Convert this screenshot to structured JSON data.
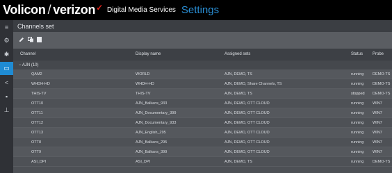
{
  "topbar": {
    "brand": "Volicon",
    "slash": "/",
    "verizon": "verizon",
    "checkmark": "✓",
    "dms": "Digital Media Services",
    "settings": "Settings"
  },
  "header": {
    "title": "Channels set"
  },
  "toolbar": {
    "icons": [
      "edit-icon",
      "copy-icon",
      "delete-icon"
    ]
  },
  "sidebar": {
    "items": [
      {
        "icon": "≡",
        "name": "menu-icon"
      },
      {
        "icon": "⚙",
        "name": "gear-icon"
      },
      {
        "icon": "✱",
        "name": "tools-icon"
      },
      {
        "icon": "▭",
        "name": "monitor-icon",
        "active": true
      },
      {
        "icon": "<",
        "name": "share-icon"
      },
      {
        "icon": "▪",
        "name": "storage-icon"
      },
      {
        "icon": "⊥",
        "name": "user-icon"
      }
    ]
  },
  "table": {
    "columns": {
      "channel": "Channel",
      "display": "Display name",
      "sets": "Assigned sets",
      "status": "Status",
      "probe": "Probe"
    },
    "group": "− AJN (10)",
    "rows": [
      {
        "channel": "QAM2",
        "display": "WORLD",
        "sets": "AJN, DEMO, TS",
        "status": "running",
        "probe": "DEMO-TS"
      },
      {
        "channel": "WHDH-HD",
        "display": "WHDH-HD",
        "sets": "AJN, DEMO, Share Channels, TS",
        "status": "running",
        "probe": "DEMO-TS"
      },
      {
        "channel": "THIS-TV",
        "display": "THIS-TV",
        "sets": "AJN, DEMO, TS",
        "status": "stopped",
        "probe": "DEMO-TS"
      },
      {
        "channel": "OTT10",
        "display": "AJN_Balkans_933",
        "sets": "AJN, DEMO, OTT CLOUD",
        "status": "running",
        "probe": "WIN7"
      },
      {
        "channel": "OTT11",
        "display": "AJN_Documentary_399",
        "sets": "AJN, DEMO, OTT CLOUD",
        "status": "running",
        "probe": "WIN7"
      },
      {
        "channel": "OTT12",
        "display": "AJN_Documentary_933",
        "sets": "AJN, DEMO, OTT CLOUD",
        "status": "running",
        "probe": "WIN7"
      },
      {
        "channel": "OTT13",
        "display": "AJN_English_295",
        "sets": "AJN, DEMO, OTT CLOUD",
        "status": "running",
        "probe": "WIN7"
      },
      {
        "channel": "OTT8",
        "display": "AJN_Balkans_295",
        "sets": "AJN, DEMO, OTT CLOUD",
        "status": "running",
        "probe": "WIN7"
      },
      {
        "channel": "OTT9",
        "display": "AJN_Balkans_399",
        "sets": "AJN, DEMO, OTT CLOUD",
        "status": "running",
        "probe": "WIN7"
      },
      {
        "channel": "ASI_DPI",
        "display": "ASI_DPI",
        "sets": "AJN, DEMO, TS",
        "status": "running",
        "probe": "DEMO-TS"
      }
    ]
  },
  "colors": {
    "accent": "#1f8bd3",
    "settings_blue": "#2a8fd6",
    "verizon_red": "#e2231a"
  }
}
